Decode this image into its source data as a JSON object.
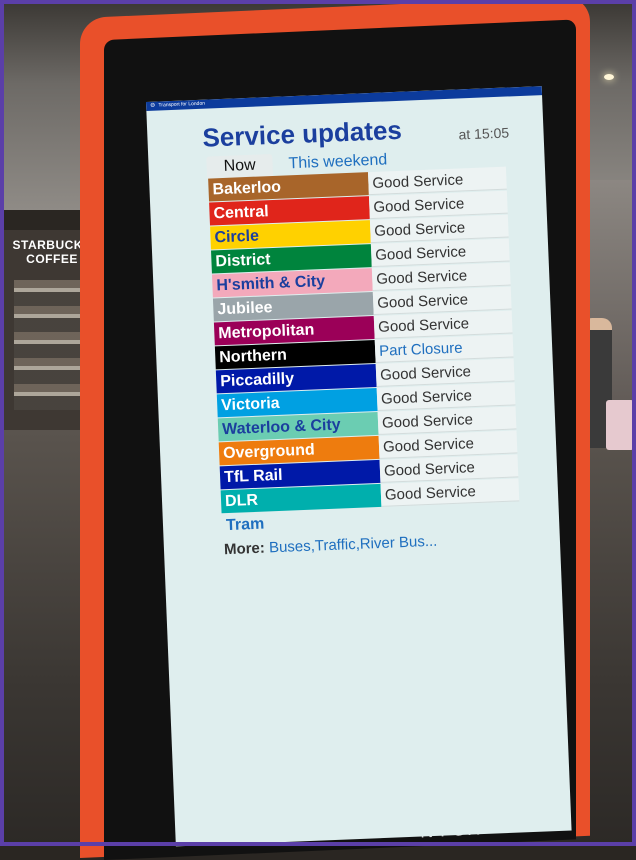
{
  "background": {
    "store_sign_line1": "STARBUCKS",
    "store_sign_line2": "COFFEE",
    "kiosk_bottom_text": "N FOR"
  },
  "screen": {
    "topbar_label": "Transport for London",
    "title": "Service updates",
    "time": "at 15:05",
    "tabs": [
      {
        "label": "Now",
        "active": true
      },
      {
        "label": "This weekend",
        "active": false
      }
    ],
    "lines": [
      {
        "name": "Bakerloo",
        "status": "Good Service",
        "color": "#a8652a",
        "text_color": "#ffffff"
      },
      {
        "name": "Central",
        "status": "Good Service",
        "color": "#e0251b",
        "text_color": "#ffffff"
      },
      {
        "name": "Circle",
        "status": "Good Service",
        "color": "#ffd100",
        "text_color": "#1b3f9e"
      },
      {
        "name": "District",
        "status": "Good Service",
        "color": "#00843d",
        "text_color": "#ffffff"
      },
      {
        "name": "H'smith & City",
        "status": "Good Service",
        "color": "#f3a9bb",
        "text_color": "#1b3f9e"
      },
      {
        "name": "Jubilee",
        "status": "Good Service",
        "color": "#9aa5aa",
        "text_color": "#ffffff"
      },
      {
        "name": "Metropolitan",
        "status": "Good Service",
        "color": "#9b0058",
        "text_color": "#ffffff"
      },
      {
        "name": "Northern",
        "status": "Part Closure",
        "color": "#000000",
        "text_color": "#ffffff"
      },
      {
        "name": "Piccadilly",
        "status": "Good Service",
        "color": "#0019a8",
        "text_color": "#ffffff"
      },
      {
        "name": "Victoria",
        "status": "Good Service",
        "color": "#00a0e2",
        "text_color": "#ffffff"
      },
      {
        "name": "Waterloo & City",
        "status": "Good Service",
        "color": "#6bcdb2",
        "text_color": "#1b3f9e"
      },
      {
        "name": "Overground",
        "status": "Good Service",
        "color": "#ee7c0e",
        "text_color": "#ffffff"
      },
      {
        "name": "TfL Rail",
        "status": "Good Service",
        "color": "#0019a8",
        "text_color": "#ffffff"
      },
      {
        "name": "DLR",
        "status": "Good Service",
        "color": "#00afad",
        "text_color": "#ffffff"
      },
      {
        "name": "Tram",
        "status": "",
        "color": "#dfeeee",
        "text_color": "#1f6fbf"
      }
    ],
    "more_label": "More:",
    "more_links": "Buses,Traffic,River Bus..."
  }
}
